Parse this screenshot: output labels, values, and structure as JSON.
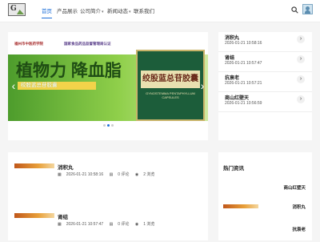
{
  "nav": {
    "items": [
      {
        "label": "首页",
        "active": true,
        "dropdown": false
      },
      {
        "label": "产品展示",
        "active": false,
        "dropdown": false
      },
      {
        "label": "公司简介",
        "active": false,
        "dropdown": true
      },
      {
        "label": "新闻动态",
        "active": false,
        "dropdown": true
      },
      {
        "label": "联系我们",
        "active": false,
        "dropdown": false
      }
    ]
  },
  "banner": {
    "brand_left": "福州市中医药学院",
    "brand_right": "国家食品药品监督管理局认证",
    "headline": "植物力 降血脂",
    "tagline": "绞股蓝总苷胶囊",
    "product_name": "绞股蓝总苷胶囊",
    "product_sub": "GYNOSTEMMA PENTAPHYLLUM CAPSULES",
    "slides": 3,
    "active_slide": 1
  },
  "sidebar_news": [
    {
      "title": "消积丸",
      "date": "2026-01-21 10:58:16"
    },
    {
      "title": "肾结",
      "date": "2026-01-21 10:57:47"
    },
    {
      "title": "抗衰老",
      "date": "2026-01-21 10:57:21"
    },
    {
      "title": "商山红壁天",
      "date": "2026-01-21 10:56:59"
    }
  ],
  "articles": [
    {
      "title": "消积丸",
      "date": "2026-01-21 10:58:16",
      "comments": "0 评论",
      "views": "2 浏览"
    },
    {
      "title": "肾结",
      "date": "2026-01-21 10:57:47",
      "comments": "0 评论",
      "views": "1 浏览"
    }
  ],
  "hot": {
    "title": "热门资讯",
    "items": [
      {
        "label": "商山红壁天"
      },
      {
        "label": "消积丸"
      },
      {
        "label": "抗衰老"
      }
    ]
  },
  "colors": {
    "accent": "#1e6fd9"
  },
  "icons": {
    "search": "search-icon",
    "avatar": "avatar-icon",
    "calendar": "calendar-icon",
    "comment": "comment-icon",
    "eye": "eye-icon"
  }
}
